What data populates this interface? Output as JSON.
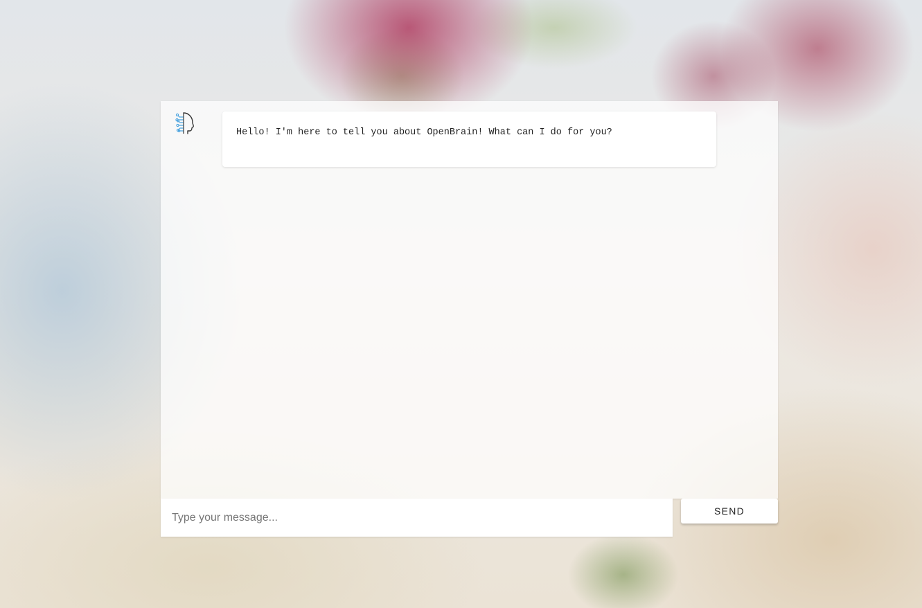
{
  "chat": {
    "messages": [
      {
        "sender": "bot",
        "avatar_icon": "brain-head-icon",
        "text": "Hello! I'm here to tell you about OpenBrain! What can I do for you?"
      }
    ]
  },
  "composer": {
    "placeholder": "Type your message...",
    "value": "",
    "send_label": "SEND"
  },
  "colors": {
    "avatar_circuit": "#4aa3df",
    "avatar_outline": "#333333",
    "panel_background": "#ffffffb8"
  }
}
